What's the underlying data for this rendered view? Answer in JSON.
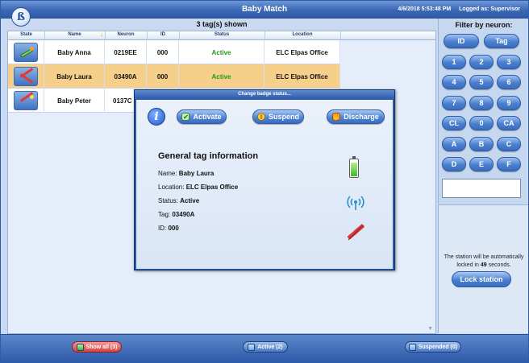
{
  "app": {
    "title": "Baby Match",
    "datetime": "4/6/2018 5:53:48 PM",
    "logged_as": "Logged as: Supervisor",
    "logo_letter": "ß"
  },
  "table": {
    "count_text": "3 tag(s) shown",
    "headers": [
      "State",
      "Name",
      "Neuron",
      "ID",
      "Status",
      "Location"
    ],
    "rows": [
      {
        "name": "Baby Anna",
        "neuron": "0219EE",
        "id": "000",
        "status": "Active",
        "location": "ELC Elpas Office",
        "selected": false
      },
      {
        "name": "Baby Laura",
        "neuron": "03490A",
        "id": "000",
        "status": "Active",
        "location": "ELC Elpas Office",
        "selected": true
      },
      {
        "name": "Baby Peter",
        "neuron": "0137C",
        "id": "",
        "status": "",
        "location": "",
        "selected": false
      }
    ]
  },
  "filter": {
    "title": "Filter by neuron:",
    "mode_buttons": [
      "ID",
      "Tag"
    ],
    "keys": [
      "1",
      "2",
      "3",
      "4",
      "5",
      "6",
      "7",
      "8",
      "9",
      "CL",
      "0",
      "CA",
      "A",
      "B",
      "C",
      "D",
      "E",
      "F"
    ],
    "input_value": ""
  },
  "lock": {
    "text_before": "The station will be automatically locked in",
    "seconds": "49",
    "text_after": "seconds.",
    "button": "Lock station"
  },
  "bottom": {
    "show_all": "Show all (3)",
    "active": "Active (2)",
    "suspended": "Suspended (0)"
  },
  "dialog": {
    "title": "Change badge status...",
    "activate": "Activate",
    "suspend": "Suspend",
    "discharge": "Discharge",
    "section_title": "General tag information",
    "name_label": "Name:",
    "name_value": "Baby Laura",
    "location_label": "Location:",
    "location_value": "ELC Elpas Office",
    "status_label": "Status:",
    "status_value": "Active",
    "tag_label": "Tag:",
    "tag_value": "03490A",
    "id_label": "ID:",
    "id_value": "000",
    "battery_level": 0.85,
    "icons": [
      "info-icon",
      "battery-icon",
      "signal-icon",
      "tamper-icon"
    ]
  },
  "colors": {
    "accent": "#2f5aa8",
    "selected_row": "#f6d08b",
    "status_active": "#1f9a1f",
    "danger": "#d94040"
  }
}
